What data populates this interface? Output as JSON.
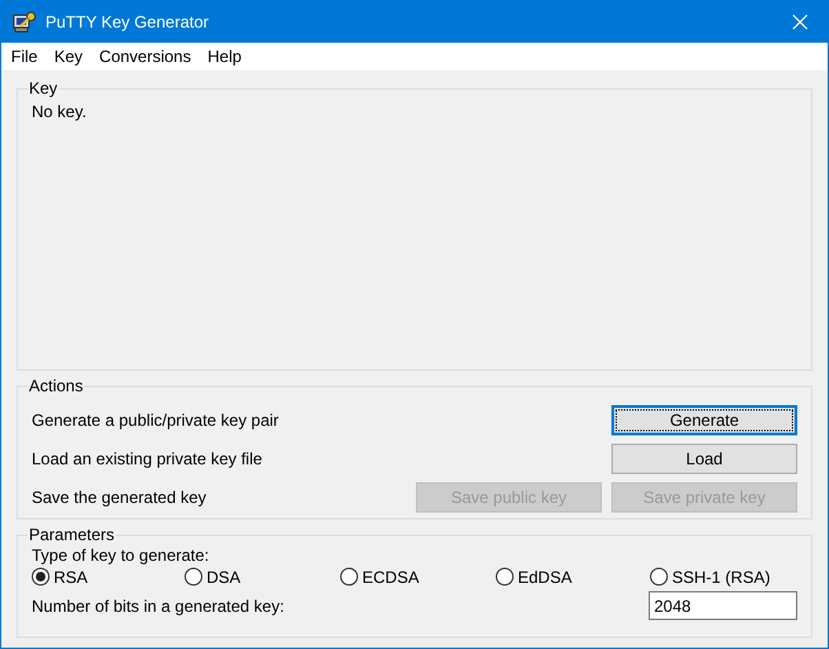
{
  "window": {
    "title": "PuTTY Key Generator"
  },
  "menu": [
    "File",
    "Key",
    "Conversions",
    "Help"
  ],
  "key_panel": {
    "title": "Key",
    "text": "No key."
  },
  "actions": {
    "title": "Actions",
    "rows": [
      {
        "label": "Generate a public/private key pair",
        "buttons": [
          {
            "label": "Generate",
            "disabled": false,
            "focused": true
          }
        ]
      },
      {
        "label": "Load an existing private key file",
        "buttons": [
          {
            "label": "Load",
            "disabled": false,
            "focused": false
          }
        ]
      },
      {
        "label": "Save the generated key",
        "buttons": [
          {
            "label": "Save public key",
            "disabled": true,
            "focused": false
          },
          {
            "label": "Save private key",
            "disabled": true,
            "focused": false
          }
        ]
      }
    ]
  },
  "parameters": {
    "title": "Parameters",
    "type_label": "Type of key to generate:",
    "key_types": [
      {
        "label": "RSA",
        "selected": true
      },
      {
        "label": "DSA",
        "selected": false
      },
      {
        "label": "ECDSA",
        "selected": false
      },
      {
        "label": "EdDSA",
        "selected": false
      },
      {
        "label": "SSH-1 (RSA)",
        "selected": false
      }
    ],
    "bits_label": "Number of bits in a generated key:",
    "bits_value": "2048"
  }
}
